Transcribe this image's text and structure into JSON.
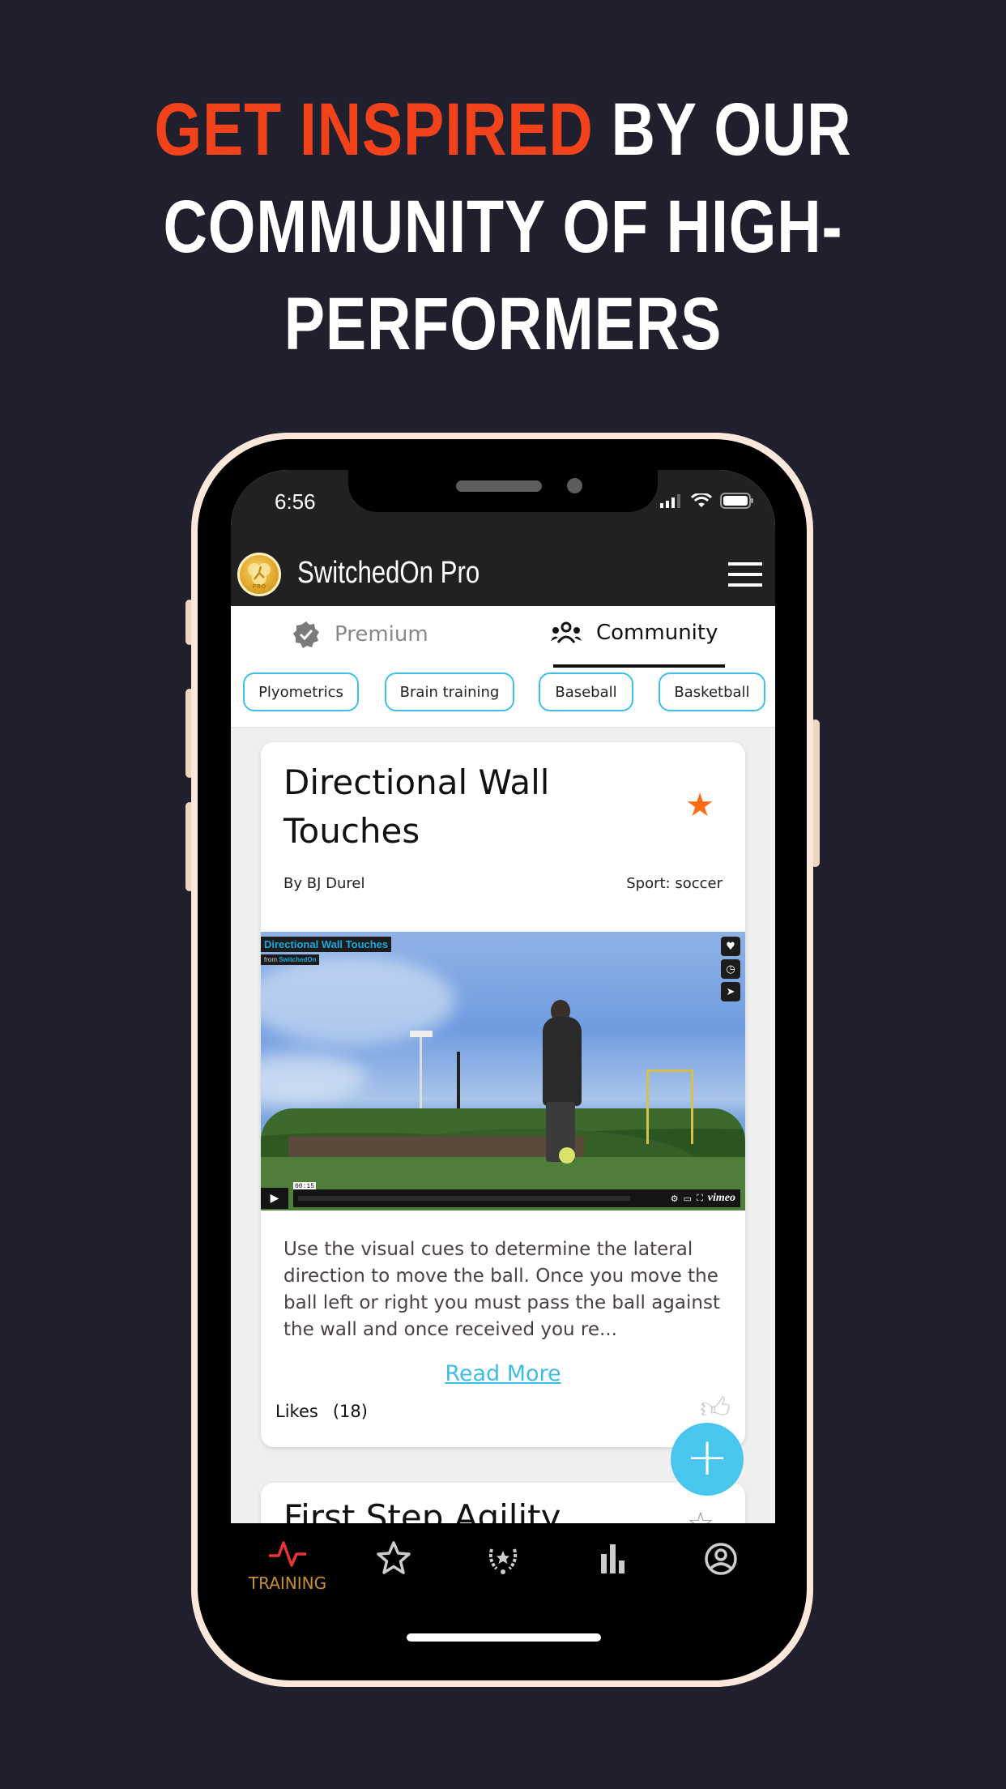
{
  "headline": {
    "accent": "GET INSPIRED",
    "rest_line1": " BY OUR",
    "line2": "COMMUNITY OF HIGH-",
    "line3": "PERFORMERS"
  },
  "status_bar": {
    "time": "6:56"
  },
  "app_bar": {
    "title": "SwitchedOn Pro",
    "logo_text": "PRO"
  },
  "tabs": [
    {
      "label": "Premium",
      "icon": "verified-badge-icon",
      "active": false
    },
    {
      "label": "Community",
      "icon": "group-icon",
      "active": true
    }
  ],
  "filters": [
    "Plyometrics",
    "Brain training",
    "Baseball",
    "Basketball"
  ],
  "cards": [
    {
      "title": "Directional Wall Touches",
      "favorited": true,
      "author": "By BJ Durel",
      "sport": "Sport: soccer",
      "video": {
        "title": "Directional Wall Touches",
        "from_label": "from",
        "from_channel": "SwitchedOn",
        "time": "00:15",
        "provider": "vimeo"
      },
      "description": "Use the visual cues to determine the lateral direction to move the ball. Once you move the ball left or right you must pass the ball against the wall and once received you re...",
      "read_more": "Read More",
      "likes_label": "Likes",
      "likes_count": "(18)"
    },
    {
      "title": "First Step Agility",
      "favorited": false
    }
  ],
  "fab": {
    "label": "+"
  },
  "bottom_nav": [
    {
      "label": "TRAINING",
      "icon": "pulse-icon",
      "active": true
    },
    {
      "label": "",
      "icon": "star-icon",
      "active": false
    },
    {
      "label": "",
      "icon": "laurel-star-icon",
      "active": false
    },
    {
      "label": "",
      "icon": "bar-chart-icon",
      "active": false
    },
    {
      "label": "",
      "icon": "account-icon",
      "active": false
    }
  ],
  "colors": {
    "background": "#1f1f2d",
    "accent_red": "#f2421b",
    "star_orange": "#ff6a13",
    "chip_border": "#3ec0e6",
    "fab": "#48c6ee",
    "nav_active_label": "#c8902f",
    "nav_active_icon": "#e8333a"
  }
}
